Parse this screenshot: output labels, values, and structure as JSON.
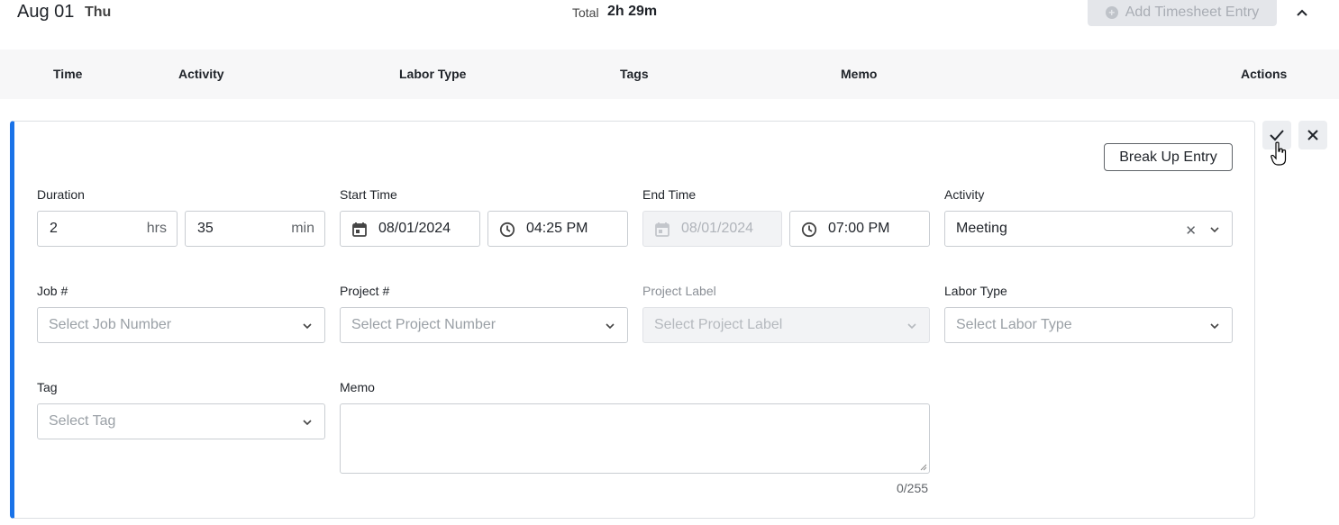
{
  "day": {
    "date": "Aug 01",
    "weekday": "Thu",
    "total_label": "Total",
    "total_value": "2h 29m",
    "add_entry_label": "Add Timesheet Entry"
  },
  "table": {
    "columns": [
      "Time",
      "Activity",
      "Labor Type",
      "Tags",
      "Memo",
      "Actions"
    ]
  },
  "editor": {
    "break_up_label": "Break Up Entry",
    "duration": {
      "label": "Duration",
      "hours": "2",
      "hours_unit": "hrs",
      "minutes": "35",
      "minutes_unit": "min"
    },
    "start_time": {
      "label": "Start Time",
      "date": "08/01/2024",
      "time": "04:25 PM"
    },
    "end_time": {
      "label": "End Time",
      "date": "08/01/2024",
      "time": "07:00 PM"
    },
    "activity": {
      "label": "Activity",
      "value": "Meeting"
    },
    "job": {
      "label": "Job #",
      "placeholder": "Select Job Number"
    },
    "project": {
      "label": "Project #",
      "placeholder": "Select Project Number"
    },
    "project_label": {
      "label": "Project Label",
      "placeholder": "Select Project Label"
    },
    "labor_type": {
      "label": "Labor Type",
      "placeholder": "Select Labor Type"
    },
    "tag": {
      "label": "Tag",
      "placeholder": "Select Tag"
    },
    "memo": {
      "label": "Memo",
      "value": "",
      "counter": "0/255"
    }
  },
  "icons": {
    "accent": "#1a73e8"
  }
}
